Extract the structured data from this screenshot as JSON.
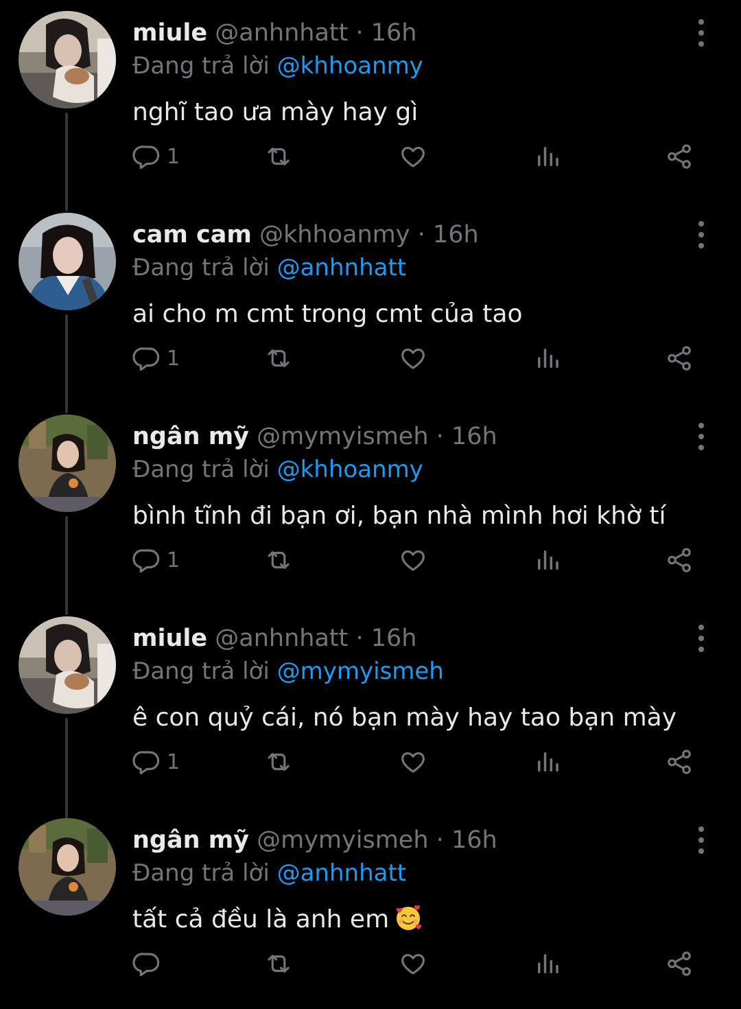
{
  "colors": {
    "background": "#000000",
    "primary_text": "#e7e9ea",
    "secondary_text": "#71767b",
    "link": "#1d9bf0",
    "thread_line": "#333639"
  },
  "labels": {
    "replying_to": "Đang trả lời"
  },
  "icons": {
    "reply": "reply-icon",
    "retweet": "retweet-icon",
    "like": "heart-icon",
    "views": "views-icon",
    "share": "share-icon",
    "more": "more-vertical-icon"
  },
  "tweets": [
    {
      "display_name": "miule",
      "handle": "@anhnhatt",
      "separator": "·",
      "time": "16h",
      "reply_to": "@khhoanmy",
      "text": "nghĩ tao ưa mày hay gì",
      "reply_count": "1"
    },
    {
      "display_name": "cam cam",
      "handle": "@khhoanmy",
      "separator": "·",
      "time": "16h",
      "reply_to": "@anhnhatt",
      "text": "ai cho m cmt trong cmt của tao",
      "reply_count": "1"
    },
    {
      "display_name": "ngân mỹ",
      "handle": "@mymyismeh",
      "separator": "·",
      "time": "16h",
      "reply_to": "@khhoanmy",
      "text": "bình tĩnh đi bạn ơi, bạn nhà mình hơi khờ tí",
      "reply_count": "1"
    },
    {
      "display_name": "miule",
      "handle": "@anhnhatt",
      "separator": "·",
      "time": "16h",
      "reply_to": "@mymyismeh",
      "text": "ê con quỷ cái, nó bạn mày hay tao bạn mày",
      "reply_count": "1"
    },
    {
      "display_name": "ngân mỹ",
      "handle": "@mymyismeh",
      "separator": "·",
      "time": "16h",
      "reply_to": "@anhnhatt",
      "text": "tất cả đều là anh em",
      "emoji": "smiling-face-with-hearts",
      "reply_count": ""
    }
  ]
}
